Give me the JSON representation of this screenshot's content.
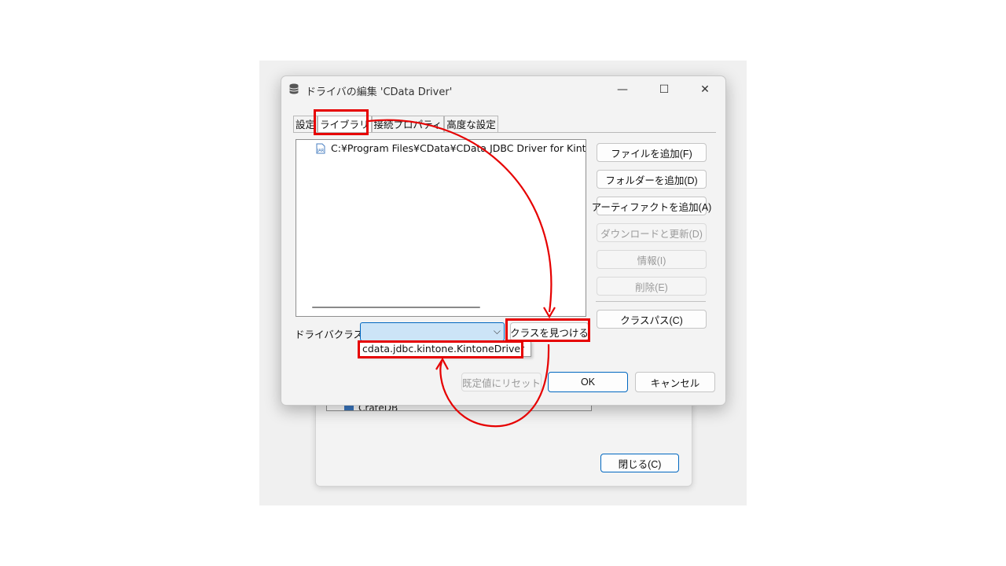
{
  "background_dialog": {
    "list_item": "CrateDB",
    "close_button": "閉じる(C)"
  },
  "dialog": {
    "title": "ドライバの編集 'CData Driver'",
    "window_controls": {
      "minimize": "—",
      "maximize": "☐",
      "close": "✕"
    },
    "tabs": [
      {
        "label": "設定",
        "active": false
      },
      {
        "label": "ライブラリ",
        "active": true
      },
      {
        "label": "接続プロパティ",
        "active": false
      },
      {
        "label": "高度な設定",
        "active": false
      }
    ],
    "library_list": [
      {
        "path": "C:¥Program Files¥CData¥CData JDBC Driver for Kintone",
        "icon": "jar-file-icon"
      }
    ],
    "side_buttons": {
      "add_file": "ファイルを追加(F)",
      "add_folder": "フォルダーを追加(D)",
      "add_artifact": "アーティファクトを追加(A)",
      "download_update": "ダウンロードと更新(D)",
      "info": "情報(I)",
      "delete": "削除(E)",
      "classpath": "クラスパス(C)"
    },
    "driver_class_label": "ドライバクラス:",
    "driver_class_value": "",
    "find_class_button": "クラスを見つける",
    "dropdown_option": "cdata.jdbc.kintone.KintoneDriver",
    "footer": {
      "reset": "既定値にリセット",
      "ok": "OK",
      "cancel": "キャンセル"
    }
  },
  "colors": {
    "highlight": "#e60000",
    "accent": "#0067c0",
    "selection": "#cce4f7"
  }
}
